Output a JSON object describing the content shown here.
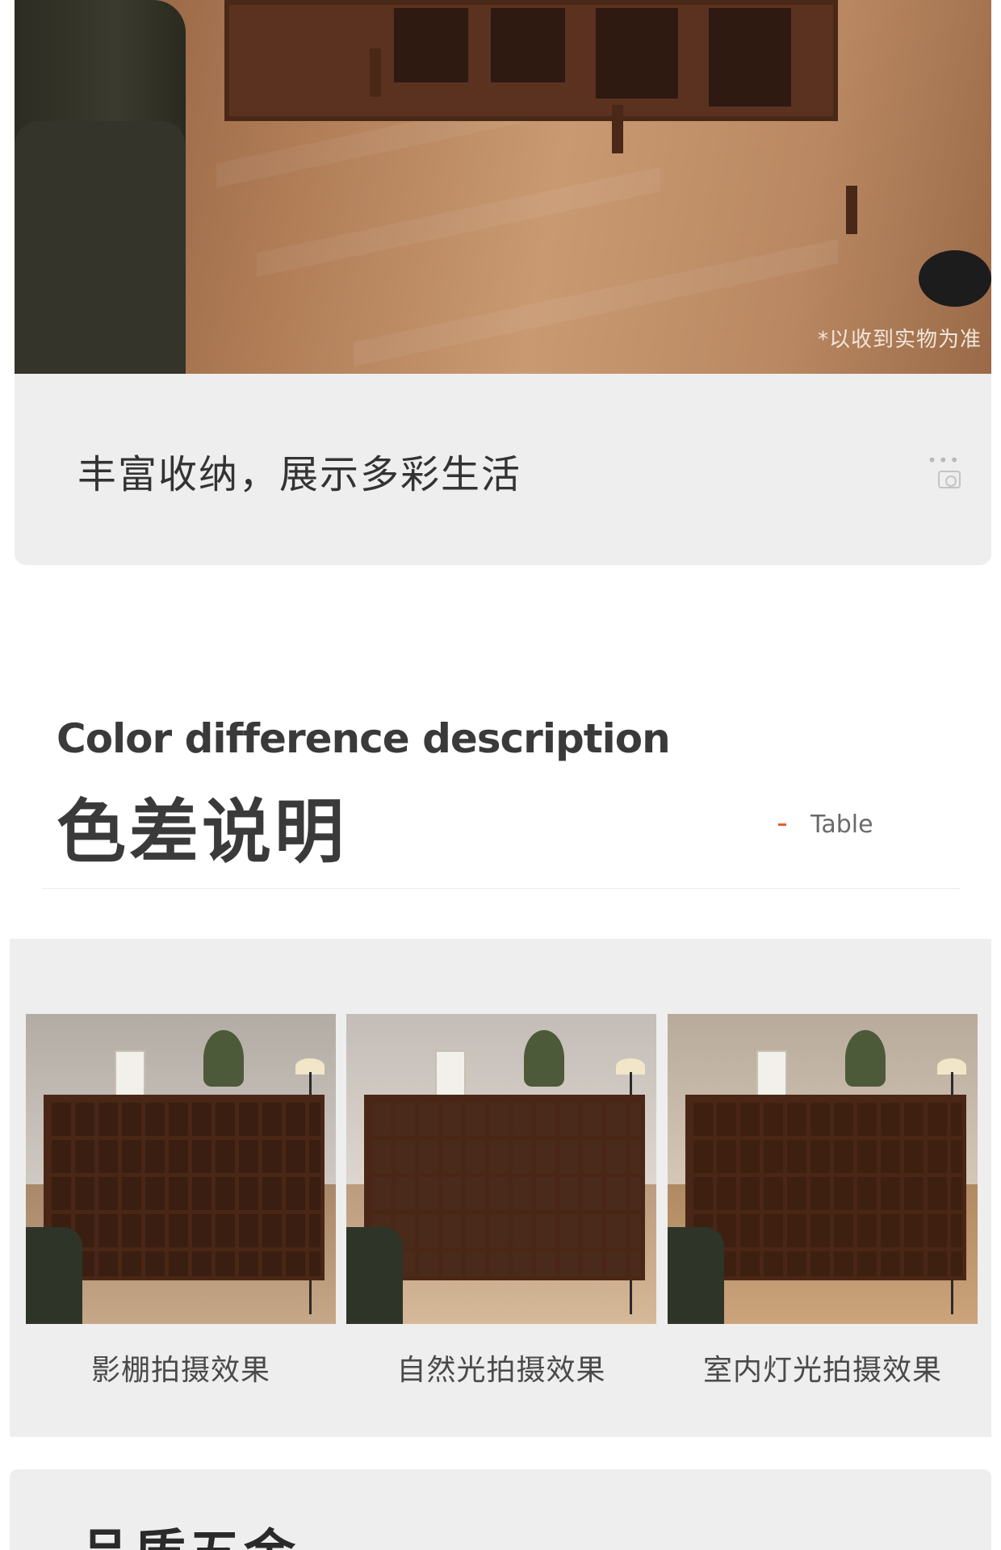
{
  "hero": {
    "note": "*以收到实物为准"
  },
  "caption": {
    "text": "丰富收纳，展示多彩生活",
    "dots": "•••"
  },
  "section": {
    "title_en": "Color difference description",
    "title_zh": "色差说明",
    "tag": "Table"
  },
  "comparison": {
    "items": [
      {
        "label": "影棚拍摄效果"
      },
      {
        "label": "自然光拍摄效果"
      },
      {
        "label": "室内灯光拍摄效果"
      }
    ]
  },
  "next_section": {
    "title": "品质五金"
  },
  "colors": {
    "accent": "#e06030",
    "panel_bg": "#eeeeee",
    "wood_dark": "#4a2616"
  }
}
